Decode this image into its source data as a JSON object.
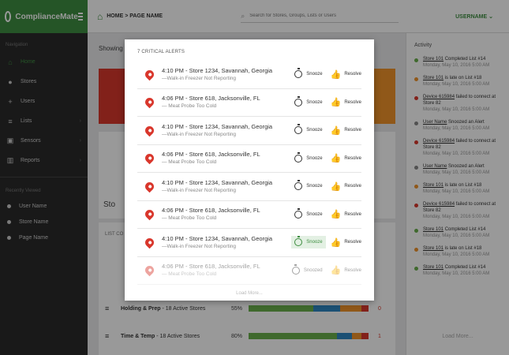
{
  "app": {
    "name": "ComplianceMate"
  },
  "sidebar": {
    "nav_heading": "Navigation",
    "items": [
      {
        "label": "Home",
        "icon": "home-icon"
      },
      {
        "label": "Stores",
        "icon": "location-pin-icon"
      },
      {
        "label": "Users",
        "icon": "add-user-icon"
      },
      {
        "label": "Lists",
        "icon": "list-icon"
      },
      {
        "label": "Sensors",
        "icon": "sensor-icon"
      },
      {
        "label": "Reports",
        "icon": "chart-icon"
      }
    ],
    "recent_heading": "Recently Viewed",
    "recent": [
      {
        "label": "User Name"
      },
      {
        "label": "Store Name"
      },
      {
        "label": "Page Name"
      }
    ]
  },
  "header": {
    "breadcrumb": "HOME > PAGE NAME",
    "search_placeholder": "Search for Stores, Groups, Lists or Users",
    "username": "USERNAME"
  },
  "main": {
    "showing": "Showing",
    "store_label": "Sto",
    "list_header": "LIST CO",
    "errors_header": "rors",
    "rows": [
      {
        "name": "Holding & Prep",
        "stores": " - 18 Active Stores",
        "pct": "55%",
        "errors": "0"
      },
      {
        "name": "Time & Temp",
        "stores": " - 18 Active Stores",
        "pct": "80%",
        "errors": "1"
      }
    ]
  },
  "activity": {
    "title": "Activity",
    "load_more": "Load More...",
    "items": [
      {
        "color": "#6ab04c",
        "link": "Store 101",
        "rest": " Completed List #14",
        "time": "Monday, May 10, 2016  5:00 AM"
      },
      {
        "color": "#f0932b",
        "link": "Store 101",
        "rest": " is late on List #18",
        "time": "Monday, May 10, 2016  5:00 AM"
      },
      {
        "color": "#d9372c",
        "link": "Device 615984",
        "rest": " failed to connect at Store 82",
        "time": "Monday, May 10, 2016  5:00 AM"
      },
      {
        "color": "#888888",
        "link": "User Name",
        "rest": " Snoozed an Alert",
        "time": "Monday, May 10, 2016  5:00 AM"
      },
      {
        "color": "#d9372c",
        "link": "Device 615984",
        "rest": " failed to connect at Store 82",
        "time": "Monday, May 10, 2016  5:00 AM"
      },
      {
        "color": "#888888",
        "link": "User Name",
        "rest": " Snoozed an Alert",
        "time": "Monday, May 10, 2016  5:00 AM"
      },
      {
        "color": "#f0932b",
        "link": "Store 101",
        "rest": " is late on List #18",
        "time": "Monday, May 10, 2016  5:00 AM"
      },
      {
        "color": "#d9372c",
        "link": "Device 615984",
        "rest": " failed to connect at Store 82",
        "time": "Monday, May 10, 2016  5:00 AM"
      },
      {
        "color": "#6ab04c",
        "link": "Store 101",
        "rest": " Completed List #14",
        "time": "Monday, May 10, 2016  5:00 AM"
      },
      {
        "color": "#f0932b",
        "link": "Store 101",
        "rest": " is late on List #18",
        "time": "Monday, May 10, 2016  5:00 AM"
      },
      {
        "color": "#6ab04c",
        "link": "Store 101",
        "rest": " Completed List #14",
        "time": "Monday, May 10, 2016  5:00 AM"
      }
    ]
  },
  "modal": {
    "title": "7 CRITICAL ALERTS",
    "snooze_label": "Snooze",
    "snoozed_label": "Snoozed",
    "resolve_label": "Resolve",
    "load_more": "Load More...",
    "alerts": [
      {
        "main": "4:10 PM - Store 1234, Savannah, Georgia",
        "sub": "—Walk-in Freezer Not Reporting"
      },
      {
        "main": "4:06 PM - Store 618, Jacksonville, FL",
        "sub": "— Meat Probe Too Cold"
      },
      {
        "main": "4:10 PM - Store 1234, Savannah, Georgia",
        "sub": "—Walk-in Freezer Not Reporting"
      },
      {
        "main": "4:06 PM - Store 618, Jacksonville, FL",
        "sub": "— Meat Probe Too Cold"
      },
      {
        "main": "4:10 PM - Store 1234, Savannah, Georgia",
        "sub": "—Walk-in Freezer Not Reporting"
      },
      {
        "main": "4:06 PM - Store 618, Jacksonville, FL",
        "sub": "— Meat Probe Too Cold"
      },
      {
        "main": "4:10 PM - Store 1234, Savannah, Georgia",
        "sub": "—Walk-in Freezer Not Reporting"
      },
      {
        "main": "4:06 PM - Store 618, Jacksonville, FL",
        "sub": "— Meat Probe Too Cold"
      }
    ]
  },
  "colors": {
    "brand": "#3e8e41",
    "critical": "#d9372c",
    "warning": "#f0932b",
    "success": "#6ab04c",
    "info": "#2e86c1"
  }
}
